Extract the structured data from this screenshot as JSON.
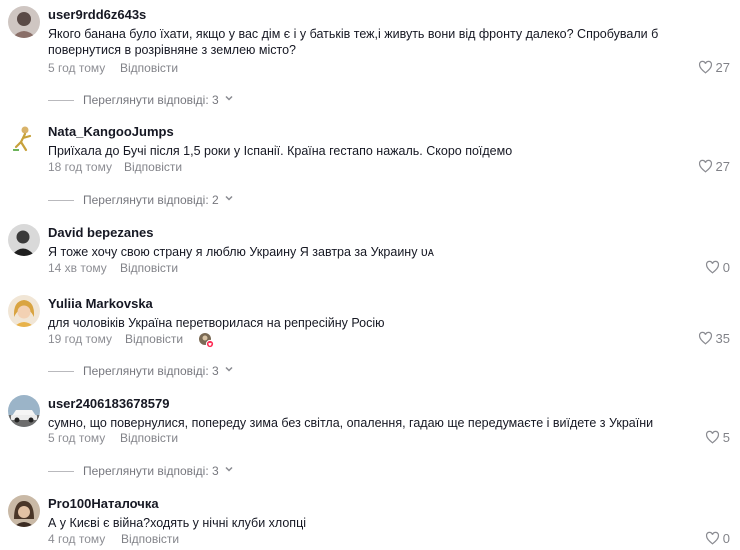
{
  "reply_label": "Відповісти",
  "comments": [
    {
      "username": "user9rdd6z643s",
      "text": "Якого банана було їхати, якщо у вас дім є і у батьків теж,і живуть вони від фронту далеко? Спробували б повернутися в розрівняне з землею місто?",
      "time": "5 год тому",
      "likes": "27",
      "view_replies": "Переглянути відповіді: 3"
    },
    {
      "username": "Nata_KangooJumps",
      "text": "Приїхала до Бучі після 1,5 роки у Іспанії. Країна гестапо нажаль. Скоро поїдемо",
      "time": "18 год тому",
      "likes": "27",
      "view_replies": "Переглянути відповіді: 2"
    },
    {
      "username": "David bepezanes",
      "text": "Я тоже хочу свою страну я люблю Украину Я завтра за Украину ᴜᴀ",
      "time": "14 хв тому",
      "likes": "0"
    },
    {
      "username": "Yuliia Markovska",
      "text": "для чоловіків Україна перетворилася на репресійну Росію",
      "time": "19 год тому",
      "likes": "35",
      "view_replies": "Переглянути відповіді: 3"
    },
    {
      "username": "user2406183678579",
      "text": "сумно, що повернулися, попереду зима без світла, опалення, гадаю ще передумаєте і виїдете з України",
      "time": "5 год тому",
      "likes": "5",
      "view_replies": "Переглянути відповіді: 3"
    },
    {
      "username": "Pro100Наталочка",
      "text": "А у Києві є війна?ходять у нічні клуби хлопці",
      "time": "4 год тому",
      "likes": "0"
    }
  ],
  "colors": {
    "text": "#161823",
    "muted": "#8a8b91",
    "heart_badge": "#fe2c55"
  },
  "icons": {
    "like": "heart-outline-icon",
    "expand": "chevron-down-icon",
    "liked_by_creator": "creator-liked-badge-icon"
  }
}
